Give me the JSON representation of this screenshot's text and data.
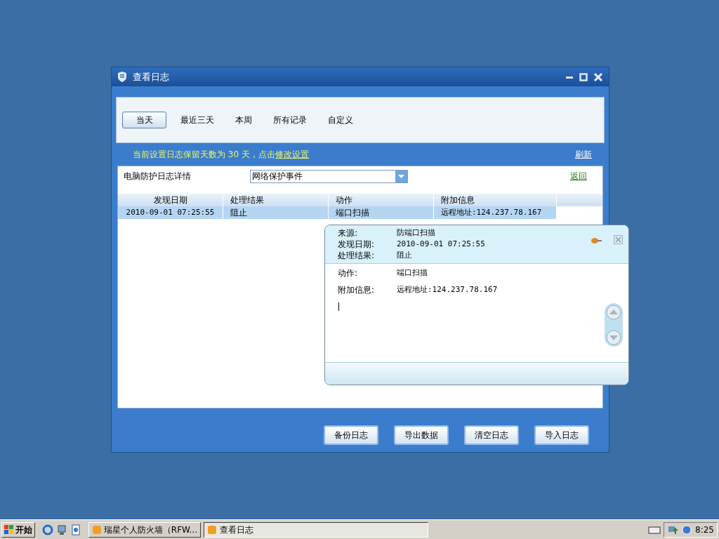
{
  "window": {
    "title": "查看日志"
  },
  "filter_tabs": [
    {
      "label": "当天",
      "selected": true
    },
    {
      "label": "最近三天",
      "selected": false
    },
    {
      "label": "本周",
      "selected": false
    },
    {
      "label": "所有记录",
      "selected": false
    },
    {
      "label": "自定义",
      "selected": false
    }
  ],
  "notice": {
    "text": "当前设置日志保留天数为 30 天，点击",
    "link": "修改设置"
  },
  "refresh_link": "刷新",
  "panel": {
    "title": "电脑防护日志详情",
    "dropdown_value": "网络保护事件",
    "back_link": "返回"
  },
  "table": {
    "columns": [
      "发现日期",
      "处理结果",
      "动作",
      "附加信息"
    ],
    "rows": [
      {
        "cells": [
          "2010-09-01 07:25:55",
          "阻止",
          "端口扫描",
          "远程地址:124.237.78.167"
        ],
        "selected": true
      }
    ]
  },
  "detail_popup": {
    "header_fields": [
      {
        "label": "来源:",
        "value": "防端口扫描"
      },
      {
        "label": "发现日期:",
        "value": "2010-09-01 07:25:55"
      },
      {
        "label": "处理结果:",
        "value": "阻止"
      }
    ],
    "body_fields": [
      {
        "label": "动作:",
        "value": "端口扫描"
      },
      {
        "label": "附加信息:",
        "value": "远程地址:124.237.78.167"
      }
    ]
  },
  "buttons": [
    "备份日志",
    "导出数据",
    "清空日志",
    "导入日志"
  ],
  "taskbar": {
    "start": "开始",
    "tasks": [
      {
        "label": "瑞星个人防火墙（RFW...",
        "selected": false
      },
      {
        "label": "查看日志",
        "selected": true
      }
    ],
    "clock": "8:25"
  }
}
